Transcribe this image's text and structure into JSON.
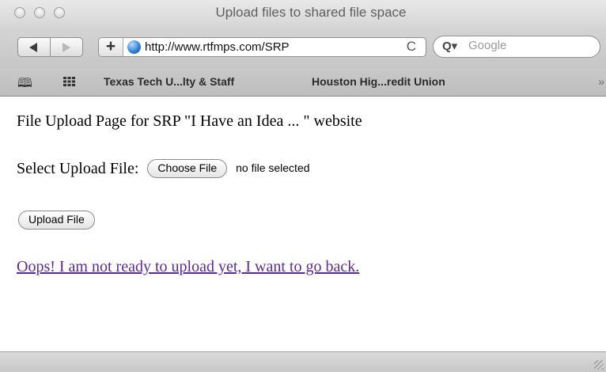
{
  "window": {
    "title": "Upload files to shared file space"
  },
  "toolbar": {
    "back_icon": "back-arrow-icon",
    "forward_icon": "forward-arrow-icon",
    "add_bookmark_label": "+",
    "address": "http://www.rtfmps.com/SRP",
    "reload_glyph": "C",
    "search_placeholder": "Google",
    "search_icon_glyph": "Q▾"
  },
  "bookmarks_bar": {
    "book_icon_glyph": "🕮",
    "items": [
      {
        "label": "Texas Tech U...lty & Staff"
      },
      {
        "label": "Houston Hig...redit Union"
      }
    ],
    "overflow_glyph": "»"
  },
  "content": {
    "heading": "File Upload Page for SRP \"I Have an Idea ... \" website",
    "file_label": "Select Upload File:",
    "choose_file_label": "Choose File",
    "no_file_text": "no file selected",
    "upload_button_label": "Upload File",
    "back_link_text": "Oops! I am not ready to upload yet, I want to go back."
  },
  "colors": {
    "link_visited": "#5a2a9a",
    "chrome_gray": "#c9c9c9"
  }
}
